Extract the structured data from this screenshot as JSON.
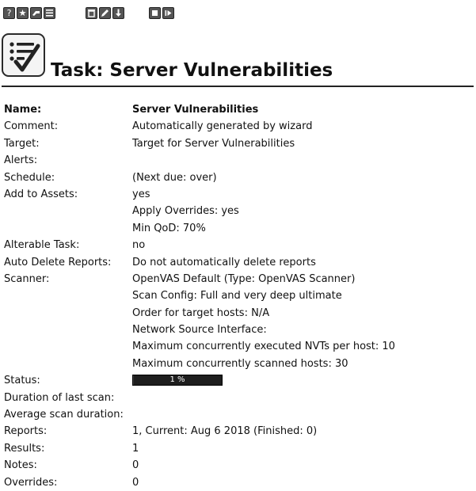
{
  "toolbar": {
    "groups": [
      {
        "buttons": [
          {
            "name": "help-icon",
            "glyph": "?"
          },
          {
            "name": "star-icon",
            "glyph": "★"
          },
          {
            "name": "task-wizard-icon",
            "glyph": ""
          },
          {
            "name": "list-icon",
            "glyph": ""
          }
        ]
      },
      {
        "buttons": [
          {
            "name": "trashcan-icon",
            "glyph": ""
          },
          {
            "name": "edit-icon",
            "glyph": ""
          },
          {
            "name": "download-icon",
            "glyph": ""
          }
        ]
      },
      {
        "buttons": [
          {
            "name": "stop-icon",
            "glyph": ""
          },
          {
            "name": "resume-icon",
            "glyph": ""
          }
        ]
      }
    ]
  },
  "page": {
    "title": "Task: Server Vulnerabilities"
  },
  "details": {
    "name_label": "Name:",
    "name_value": "Server Vulnerabilities",
    "comment_label": "Comment:",
    "comment_value": "Automatically generated by wizard",
    "target_label": "Target:",
    "target_value": "Target for Server Vulnerabilities",
    "alerts_label": "Alerts:",
    "schedule_label": "Schedule:",
    "schedule_value": "(Next due: over)",
    "add_assets_label": "Add to Assets:",
    "add_assets_value": "yes",
    "apply_overrides": "Apply Overrides: yes",
    "min_qod": "Min QoD: 70%",
    "alterable_label": "Alterable Task:",
    "alterable_value": "no",
    "auto_delete_label": "Auto Delete Reports:",
    "auto_delete_value": "Do not automatically delete reports",
    "scanner_label": "Scanner:",
    "scanner_value": "OpenVAS Default (Type: OpenVAS Scanner)",
    "scan_config": "Scan Config: Full and very deep ultimate",
    "order_hosts": "Order for target hosts: N/A",
    "network_source": "Network Source Interface:",
    "max_nvts": "Maximum concurrently executed NVTs per host: 10",
    "max_hosts": "Maximum concurrently scanned hosts: 30",
    "status_label": "Status:",
    "status_progress_text": "1 %",
    "status_progress_percent": 1,
    "duration_label": "Duration of last scan:",
    "avg_duration_label": "Average scan duration:",
    "reports_label": "Reports:",
    "reports_value": "1, Current: Aug 6 2018 (Finished: 0)",
    "results_label": "Results:",
    "results_value": "1",
    "notes_label": "Notes:",
    "notes_value": "0",
    "overrides_label": "Overrides:",
    "overrides_value": "0"
  }
}
